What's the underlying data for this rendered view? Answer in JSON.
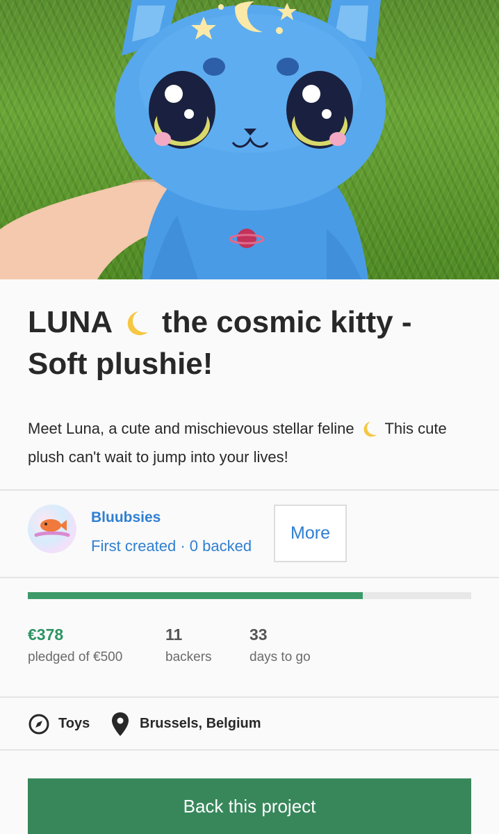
{
  "project": {
    "title_part1": "LUNA",
    "title_part2": "the cosmic kitty -",
    "title_part3": "Soft plushie!",
    "description_part1": "Meet Luna, a cute and mischievous stellar feline",
    "description_part2": "This cute plush can't wait to jump into your lives!"
  },
  "creator": {
    "name": "Bluubsies",
    "meta": "First created · 0 backed",
    "avatar_text": "Bluubsies",
    "more_label": "More"
  },
  "funding": {
    "progress_fraction": 0.756,
    "pledged_amount": "€378",
    "pledged_label": "pledged of €500",
    "backers_count": "11",
    "backers_label": "backers",
    "days_count": "33",
    "days_label": "days to go"
  },
  "tags": {
    "category": "Toys",
    "category_icon": "compass-icon",
    "location": "Brussels, Belgium",
    "location_icon": "map-pin-icon"
  },
  "cta": {
    "back_label": "Back this project"
  },
  "colors": {
    "link_blue": "#2f7fd1",
    "progress_green": "#3e9a69",
    "button_green": "#37875b",
    "pledged_green": "#2e9463"
  }
}
